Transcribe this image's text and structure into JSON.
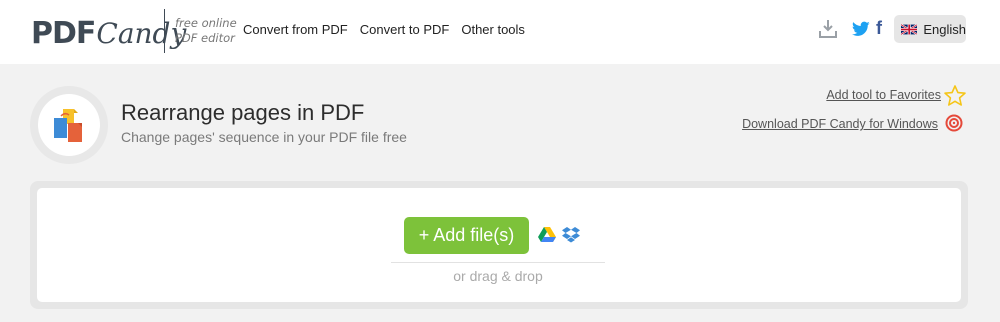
{
  "header": {
    "logo": {
      "pdf": "PDF",
      "candy": "Candy"
    },
    "tagline": [
      "free online",
      "PDF editor"
    ],
    "nav": [
      {
        "label": "Convert from PDF"
      },
      {
        "label": "Convert to PDF"
      },
      {
        "label": "Other tools"
      }
    ],
    "icons": [
      "download-icon",
      "twitter-icon",
      "facebook-icon"
    ],
    "language": {
      "label": "English",
      "flag": "uk-flag-icon"
    }
  },
  "tool": {
    "title": "Rearrange pages in PDF",
    "subtitle": "Change pages' sequence in your PDF file free",
    "icon": "rearrange-pages-icon",
    "favorites_label": "Add tool to Favorites",
    "download_label": "Download PDF Candy for Windows"
  },
  "upload": {
    "add_button_label": "+ Add file(s)",
    "drag_text": "or drag & drop",
    "cloud_icons": [
      "google-drive-icon",
      "dropbox-icon"
    ]
  },
  "colors": {
    "accent_green": "#7dc23a",
    "twitter_blue": "#1da1f2",
    "facebook_blue": "#3b5998",
    "logo_dark": "#3f4a55",
    "star_yellow": "#f5c518",
    "windows_red": "#e5493a"
  }
}
